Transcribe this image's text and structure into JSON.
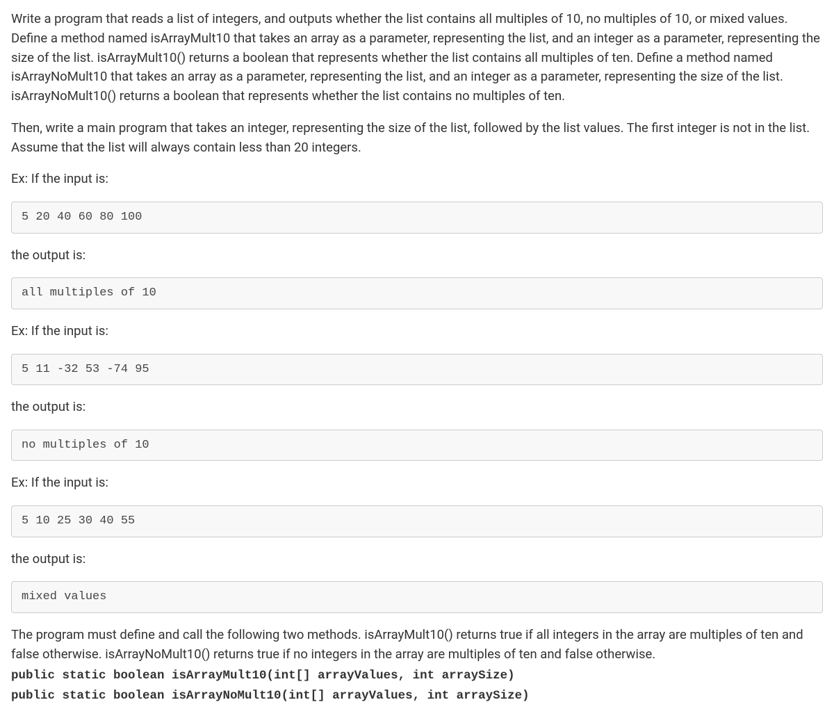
{
  "para1": "Write a program that reads a list of integers, and outputs whether the list contains all multiples of 10, no multiples of 10, or mixed values. Define a method named isArrayMult10 that takes an array as a parameter, representing the list, and an integer as a parameter, representing the size of the list. isArrayMult10() returns a boolean that represents whether the list contains all multiples of ten. Define a method named isArrayNoMult10 that takes an array as a parameter, representing the list, and an integer as a parameter, representing the size of the list. isArrayNoMult10() returns a boolean that represents whether the list contains no multiples of ten.",
  "para2": "Then, write a main program that takes an integer, representing the size of the list, followed by the list values. The first integer is not in the list. Assume that the list will always contain less than 20 integers.",
  "ex1_label": "Ex: If the input is:",
  "ex1_input": "5 20 40 60 80 100",
  "ex1_out_label": "the output is:",
  "ex1_output": "all multiples of 10",
  "ex2_label": "Ex: If the input is:",
  "ex2_input": "5 11 -32 53 -74 95",
  "ex2_out_label": "the output is:",
  "ex2_output": "no multiples of 10",
  "ex3_label": "Ex: If the input is:",
  "ex3_input": "5 10 25 30 40 55",
  "ex3_out_label": "the output is:",
  "ex3_output": "mixed values",
  "para3": "The program must define and call the following two methods. isArrayMult10() returns true if all integers in the array are multiples of ten and false otherwise. isArrayNoMult10() returns true if no integers in the array are multiples of ten and false otherwise.",
  "sig1": "public static boolean isArrayMult10(int[] arrayValues, int arraySize)",
  "sig2": "public static boolean isArrayNoMult10(int[] arrayValues, int arraySize)"
}
